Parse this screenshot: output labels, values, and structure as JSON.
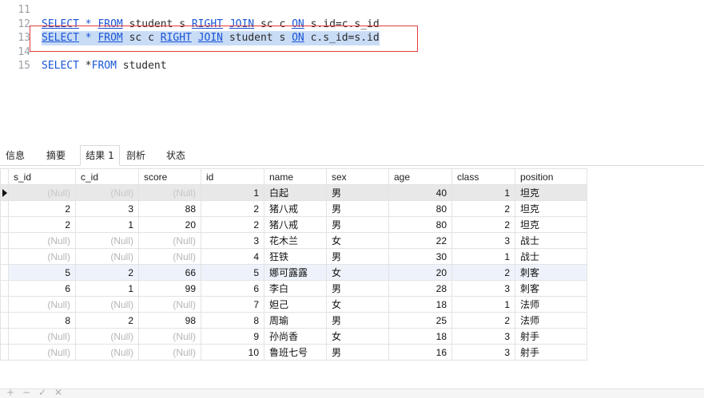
{
  "editor": {
    "lines": [
      {
        "num": "11",
        "code": ""
      },
      {
        "num": "12",
        "parts": [
          {
            "t": "kw",
            "v": "SELECT"
          },
          {
            "t": "sp",
            "v": " "
          },
          {
            "t": "kwp",
            "v": "*"
          },
          {
            "t": "sp",
            "v": " "
          },
          {
            "t": "kw",
            "v": "FROM"
          },
          {
            "t": "id",
            "v": " student s "
          },
          {
            "t": "kw",
            "v": "RIGHT"
          },
          {
            "t": "sp",
            "v": " "
          },
          {
            "t": "kw",
            "v": "JOIN"
          },
          {
            "t": "id",
            "v": " sc c "
          },
          {
            "t": "kw",
            "v": "ON"
          },
          {
            "t": "id",
            "v": " s.id=c.s_id"
          }
        ]
      },
      {
        "num": "13",
        "selected": true,
        "parts": [
          {
            "t": "kw",
            "v": "SELECT"
          },
          {
            "t": "sp",
            "v": " "
          },
          {
            "t": "kwp",
            "v": "*"
          },
          {
            "t": "sp",
            "v": " "
          },
          {
            "t": "kw",
            "v": "FROM"
          },
          {
            "t": "id",
            "v": " sc c "
          },
          {
            "t": "kw",
            "v": "RIGHT"
          },
          {
            "t": "sp",
            "v": " "
          },
          {
            "t": "kw",
            "v": "JOIN"
          },
          {
            "t": "id",
            "v": " student s "
          },
          {
            "t": "kw",
            "v": "ON"
          },
          {
            "t": "id",
            "v": " c.s_id=s.id"
          }
        ]
      },
      {
        "num": "14",
        "code": ""
      },
      {
        "num": "15",
        "parts": [
          {
            "t": "kwp",
            "v": "SELECT"
          },
          {
            "t": "id",
            "v": " *"
          },
          {
            "t": "kwp",
            "v": "FROM"
          },
          {
            "t": "id",
            "v": " student"
          }
        ]
      }
    ]
  },
  "tabs": [
    "信息",
    "摘要",
    "结果 1",
    "剖析",
    "状态"
  ],
  "active_tab": "结果 1",
  "grid": {
    "columns": [
      "s_id",
      "c_id",
      "score",
      "id",
      "name",
      "sex",
      "age",
      "class",
      "position"
    ],
    "rows": [
      [
        "(Null)",
        "(Null)",
        "(Null)",
        "1",
        "白起",
        "男",
        "40",
        "1",
        "坦克"
      ],
      [
        "2",
        "3",
        "88",
        "2",
        "猪八戒",
        "男",
        "80",
        "2",
        "坦克"
      ],
      [
        "2",
        "1",
        "20",
        "2",
        "猪八戒",
        "男",
        "80",
        "2",
        "坦克"
      ],
      [
        "(Null)",
        "(Null)",
        "(Null)",
        "3",
        "花木兰",
        "女",
        "22",
        "3",
        "战士"
      ],
      [
        "(Null)",
        "(Null)",
        "(Null)",
        "4",
        "狂铁",
        "男",
        "30",
        "1",
        "战士"
      ],
      [
        "5",
        "2",
        "66",
        "5",
        "娜可露露",
        "女",
        "20",
        "2",
        "刺客"
      ],
      [
        "6",
        "1",
        "99",
        "6",
        "李白",
        "男",
        "28",
        "3",
        "刺客"
      ],
      [
        "(Null)",
        "(Null)",
        "(Null)",
        "7",
        "妲己",
        "女",
        "18",
        "1",
        "法师"
      ],
      [
        "8",
        "2",
        "98",
        "8",
        "周瑜",
        "男",
        "25",
        "2",
        "法师"
      ],
      [
        "(Null)",
        "(Null)",
        "(Null)",
        "9",
        "孙尚香",
        "女",
        "18",
        "3",
        "射手"
      ],
      [
        "(Null)",
        "(Null)",
        "(Null)",
        "10",
        "鲁班七号",
        "男",
        "16",
        "3",
        "射手"
      ]
    ]
  },
  "bottombar": {
    "add": "+",
    "remove": "−",
    "confirm": "✓",
    "cancel": "✕"
  },
  "colors": {
    "keyword": "#1a55d6",
    "selection": "#c9dcf6",
    "highlight_box": "#e23b3b",
    "null_text": "#b5b5b5"
  }
}
